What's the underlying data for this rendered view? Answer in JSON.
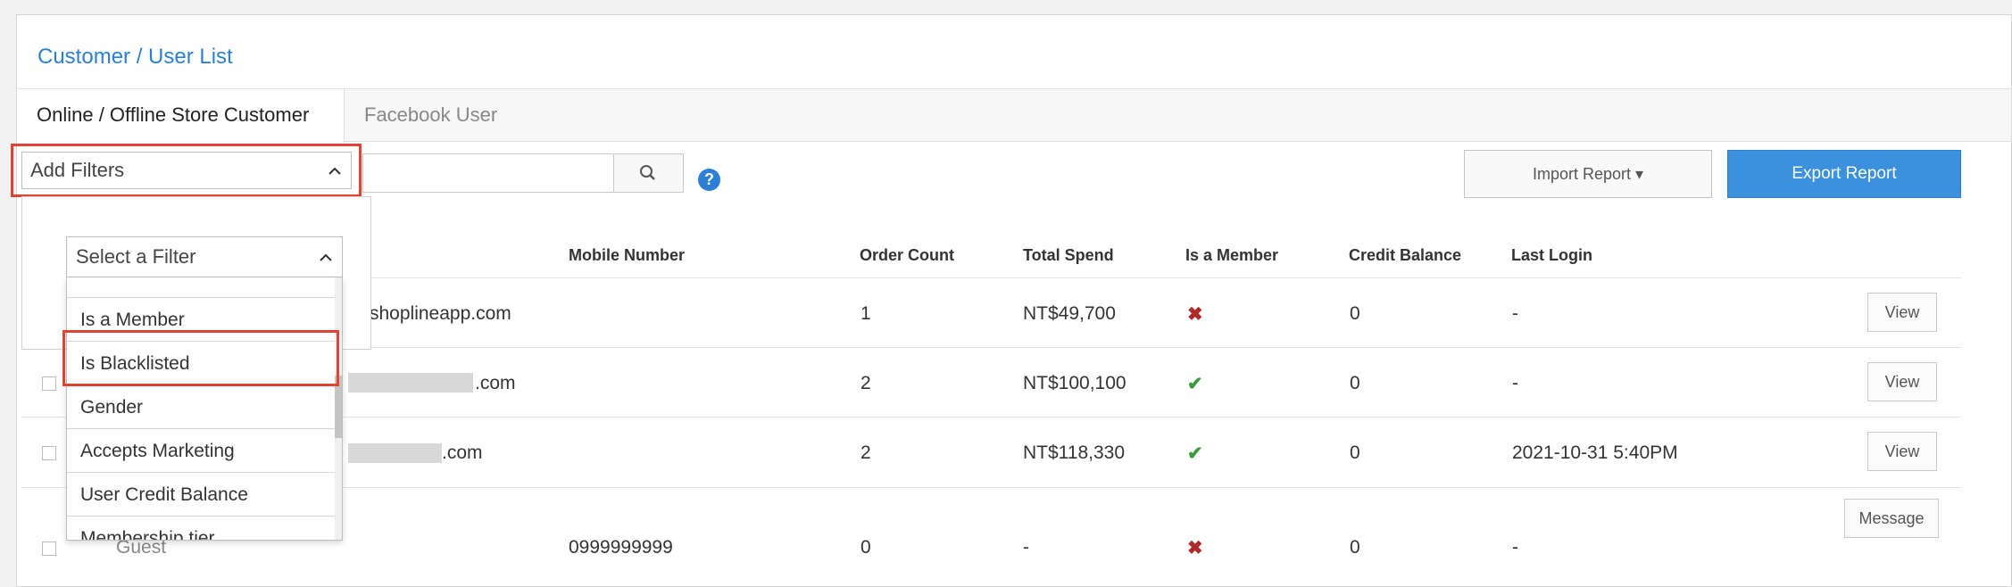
{
  "page": {
    "title": "Customer / User List"
  },
  "tabs": [
    {
      "label": "Online / Offline Store Customer",
      "active": true
    },
    {
      "label": "Facebook User",
      "active": false
    }
  ],
  "filters": {
    "add_filters_label": "Add Filters",
    "select_filter_label": "Select a Filter",
    "options": [
      "Is a Member",
      "Is Blacklisted",
      "Gender",
      "Accepts Marketing",
      "User Credit Balance",
      "Membership tier"
    ],
    "highlighted_option": "Is Blacklisted"
  },
  "search": {
    "placeholder": ""
  },
  "actions": {
    "import_label": "Import Report ▾",
    "export_label": "Export Report"
  },
  "table": {
    "headers": [
      "Mobile Number",
      "Order Count",
      "Total Spend",
      "Is a Member",
      "Credit Balance",
      "Last Login"
    ],
    "rows": [
      {
        "email": "shoplineapp.com",
        "mobile": "",
        "orders": "1",
        "spend": "NT$49,700",
        "member": "✖",
        "credit": "0",
        "last_login": "-",
        "action": "View"
      },
      {
        "email": ".com",
        "mobile": "",
        "orders": "2",
        "spend": "NT$100,100",
        "member": "✔",
        "credit": "0",
        "last_login": "-",
        "action": "View"
      },
      {
        "email": ".com",
        "mobile": "",
        "orders": "2",
        "spend": "NT$118,330",
        "member": "✔",
        "credit": "0",
        "last_login": "2021-10-31 5:40PM",
        "action": "View"
      },
      {
        "name": "Guest",
        "mobile": "0999999999",
        "orders": "0",
        "spend": "-",
        "member": "✖",
        "credit": "0",
        "last_login": "-",
        "action": "Message"
      }
    ]
  },
  "colors": {
    "accent": "#2b7fd4",
    "highlight": "#e0432f",
    "export": "#3b91de"
  }
}
